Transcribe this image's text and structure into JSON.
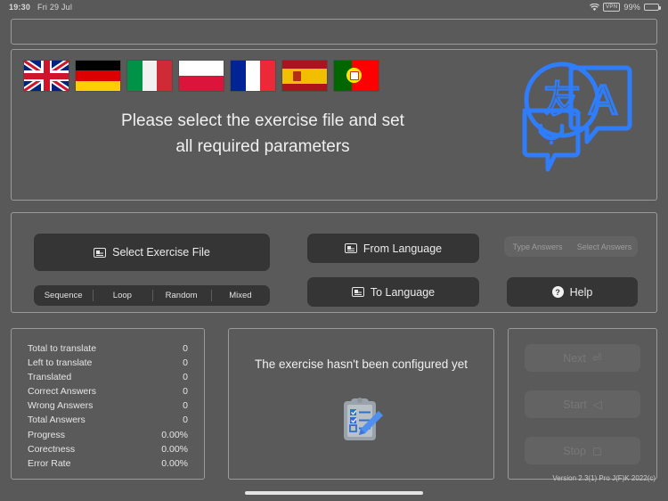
{
  "statusbar": {
    "time": "19:30",
    "date": "Fri 29 Jul",
    "wifi_icon": "wifi-icon",
    "vpn_label": "VPN",
    "battery_percent": "99%",
    "battery_icon": "battery-icon"
  },
  "hero": {
    "flags": [
      {
        "name": "flag-united-kingdom",
        "label": "United Kingdom"
      },
      {
        "name": "flag-germany",
        "label": "Germany"
      },
      {
        "name": "flag-italy",
        "label": "Italy"
      },
      {
        "name": "flag-poland",
        "label": "Poland"
      },
      {
        "name": "flag-france",
        "label": "France"
      },
      {
        "name": "flag-spain",
        "label": "Spain"
      },
      {
        "name": "flag-portugal",
        "label": "Portugal"
      }
    ],
    "message_line1": "Please select the exercise file and set",
    "message_line2": "all required parameters",
    "logo_icon": "translate-icon",
    "logo_glyph_cjk": "友",
    "logo_glyph_latin": "A",
    "logo_accent_color": "#2f7dfb"
  },
  "controls": {
    "select_file_label": "Select Exercise File",
    "from_language_label": "From Language",
    "to_language_label": "To Language",
    "help_label": "Help",
    "help_icon": "question-mark-icon",
    "file_icon": "document-icon",
    "mode_segments": [
      "Sequence",
      "Loop",
      "Random",
      "Mixed"
    ],
    "answer_segments": [
      "Type Answers",
      "Select Answers"
    ]
  },
  "stats": {
    "rows": [
      {
        "label": "Total to translate",
        "value": "0"
      },
      {
        "label": "Left to translate",
        "value": "0"
      },
      {
        "label": "Translated",
        "value": "0"
      },
      {
        "label": "Correct Answers",
        "value": "0"
      },
      {
        "label": "Wrong Answers",
        "value": "0"
      },
      {
        "label": "Total Answers",
        "value": "0"
      },
      {
        "label": "Progress",
        "value": "0.00%"
      },
      {
        "label": "Corectness",
        "value": "0.00%"
      },
      {
        "label": "Error Rate",
        "value": "0.00%"
      }
    ]
  },
  "center": {
    "message": "The exercise hasn't been configured yet",
    "icon": "clipboard-checklist-pencil-icon"
  },
  "actions": {
    "next_label": "Next",
    "next_glyph": "⏎",
    "start_label": "Start",
    "start_glyph": "◁",
    "stop_label": "Stop",
    "stop_glyph": "◻"
  },
  "footer": {
    "version": "Version 2.3(1) Pro J(F)K 2022(c)"
  }
}
